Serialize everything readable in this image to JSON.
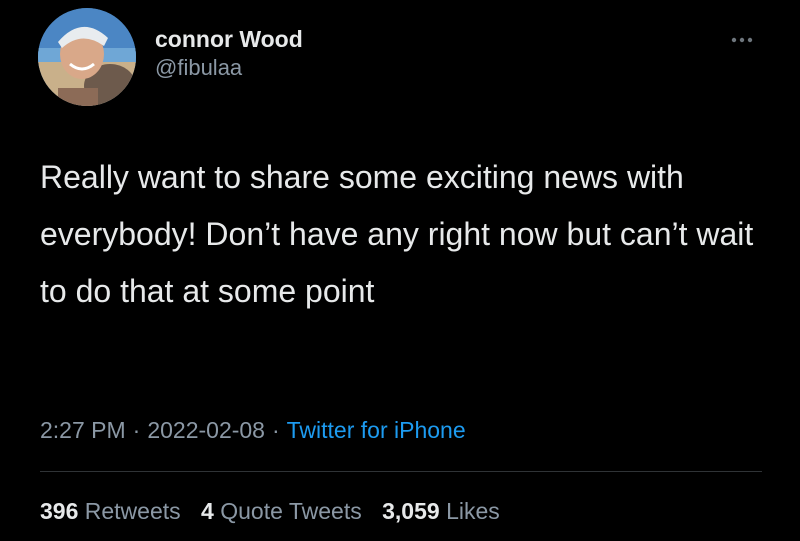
{
  "author": {
    "display_name": "connor Wood",
    "handle": "@fibulaa",
    "avatar_icon": "profile-photo"
  },
  "tweet": {
    "text": "Really want to share some exciting news with everybody! Don’t have any right now but can’t wait to do that at some point"
  },
  "meta": {
    "time": "2:27 PM",
    "separator": "·",
    "date": "2022-02-08",
    "source": "Twitter for iPhone"
  },
  "stats": {
    "retweets_count": "396",
    "retweets_label": "Retweets",
    "quotes_count": "4",
    "quotes_label": "Quote Tweets",
    "likes_count": "3,059",
    "likes_label": "Likes"
  },
  "colors": {
    "background": "#000000",
    "text": "#e7e9ea",
    "secondary": "#8b98a5",
    "link": "#1d9bf0",
    "divider": "#2f3336"
  },
  "icons": {
    "more": "more-dots-icon"
  }
}
